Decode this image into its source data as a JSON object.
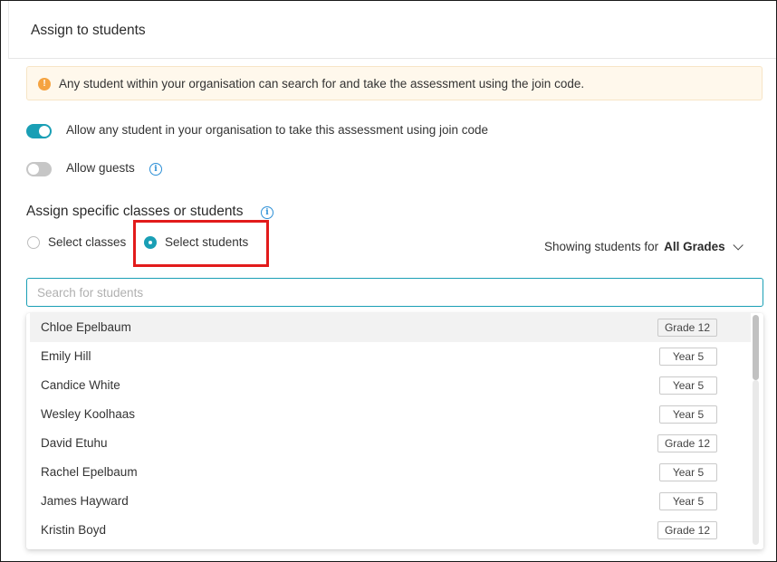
{
  "dialog": {
    "title": "Assign to students"
  },
  "alert": {
    "icon": "warning-icon",
    "text": "Any student within your organisation can search for and take the assessment using the join code."
  },
  "toggles": [
    {
      "label": "Allow any student in your organisation to take this assessment using join code",
      "on": true
    },
    {
      "label": "Allow guests",
      "on": false
    }
  ],
  "section": {
    "title": "Assign specific classes or students",
    "radios": [
      {
        "label": "Select classes",
        "selected": false
      },
      {
        "label": "Select students",
        "selected": true
      }
    ]
  },
  "filter": {
    "label": "Showing students for",
    "value": "All Grades"
  },
  "search": {
    "placeholder": "Search for students",
    "value": ""
  },
  "students": [
    {
      "name": "Chloe Epelbaum",
      "grade": "Grade 12"
    },
    {
      "name": "Emily Hill",
      "grade": "Year 5"
    },
    {
      "name": "Candice White",
      "grade": "Year 5"
    },
    {
      "name": "Wesley Koolhaas",
      "grade": "Year 5"
    },
    {
      "name": "David Etuhu",
      "grade": "Grade 12"
    },
    {
      "name": "Rachel Epelbaum",
      "grade": "Year 5"
    },
    {
      "name": "James Hayward",
      "grade": "Year 5"
    },
    {
      "name": "Kristin Boyd",
      "grade": "Grade 12"
    }
  ],
  "colors": {
    "accent": "#1a9fb5",
    "highlight": "#e21b1b",
    "alert_bg": "#fff8ec",
    "alert_icon": "#f5a341"
  }
}
